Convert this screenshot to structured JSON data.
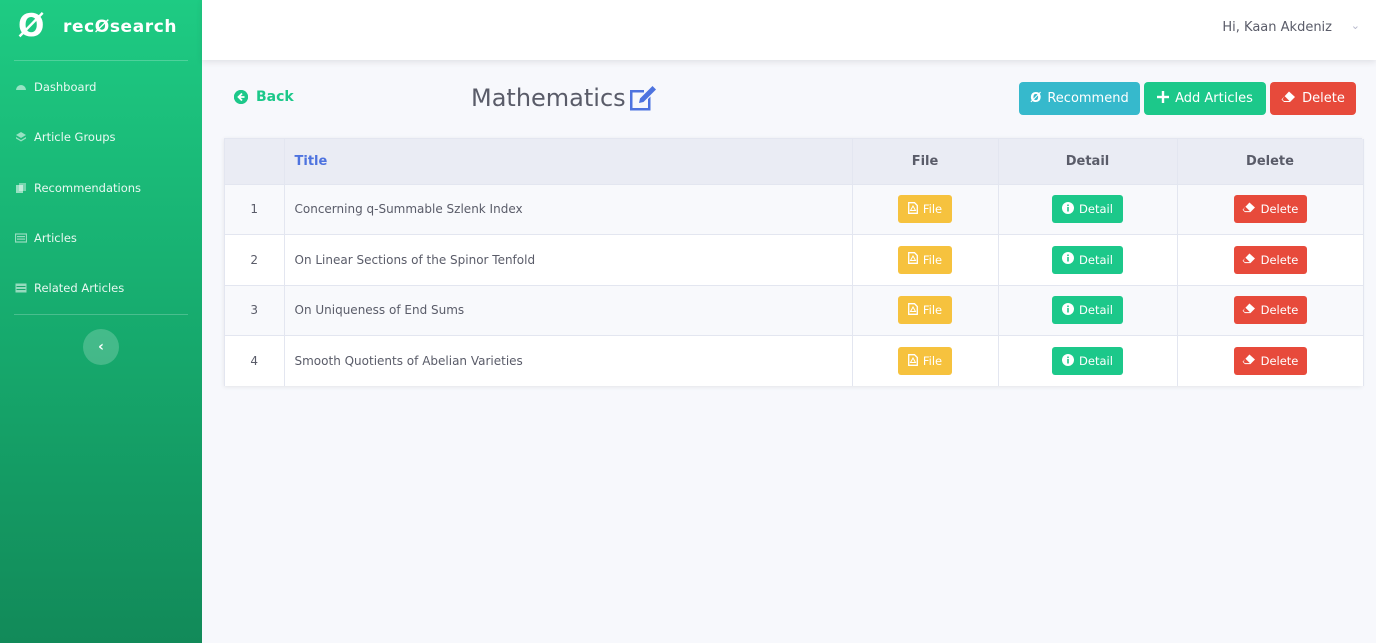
{
  "brand": {
    "logo_glyph": "Ø",
    "name": "recØsearch"
  },
  "sidebar": {
    "items": [
      {
        "label": "Dashboard",
        "icon": "tachometer-icon"
      },
      {
        "label": "Article Groups",
        "icon": "layers-icon"
      },
      {
        "label": "Recommendations",
        "icon": "copy-icon"
      },
      {
        "label": "Articles",
        "icon": "list-alt-icon"
      },
      {
        "label": "Related Articles",
        "icon": "table-icon"
      }
    ],
    "collapse_glyph": "‹"
  },
  "topbar": {
    "greeting": "Hi, Kaan Akdeniz",
    "caret": "⌄"
  },
  "header": {
    "back_label": "Back",
    "title": "Mathematics",
    "recommend_label": "Recommend",
    "recommend_glyph": "Ø",
    "add_label": "Add Articles",
    "add_glyph": "+",
    "delete_label": "Delete"
  },
  "table": {
    "columns": [
      "",
      "Title",
      "File",
      "Detail",
      "Delete"
    ],
    "rows": [
      {
        "num": "1",
        "title": "Concerning q-Summable Szlenk Index",
        "file": "File",
        "detail": "Detail",
        "delete": "Delete"
      },
      {
        "num": "2",
        "title": "On Linear Sections of the Spinor Tenfold",
        "file": "File",
        "detail": "Detail",
        "delete": "Delete"
      },
      {
        "num": "3",
        "title": "On Uniqueness of End Sums",
        "file": "File",
        "detail": "Detail",
        "delete": "Delete"
      },
      {
        "num": "4",
        "title": "Smooth Quotients of Abelian Varieties",
        "file": "File",
        "detail": "Detail",
        "delete": "Delete"
      }
    ]
  },
  "colors": {
    "primary_green": "#1cc88a",
    "info": "#36b9cc",
    "danger": "#e74a3b",
    "warning": "#f6c23e",
    "title_blue": "#4e73df"
  }
}
